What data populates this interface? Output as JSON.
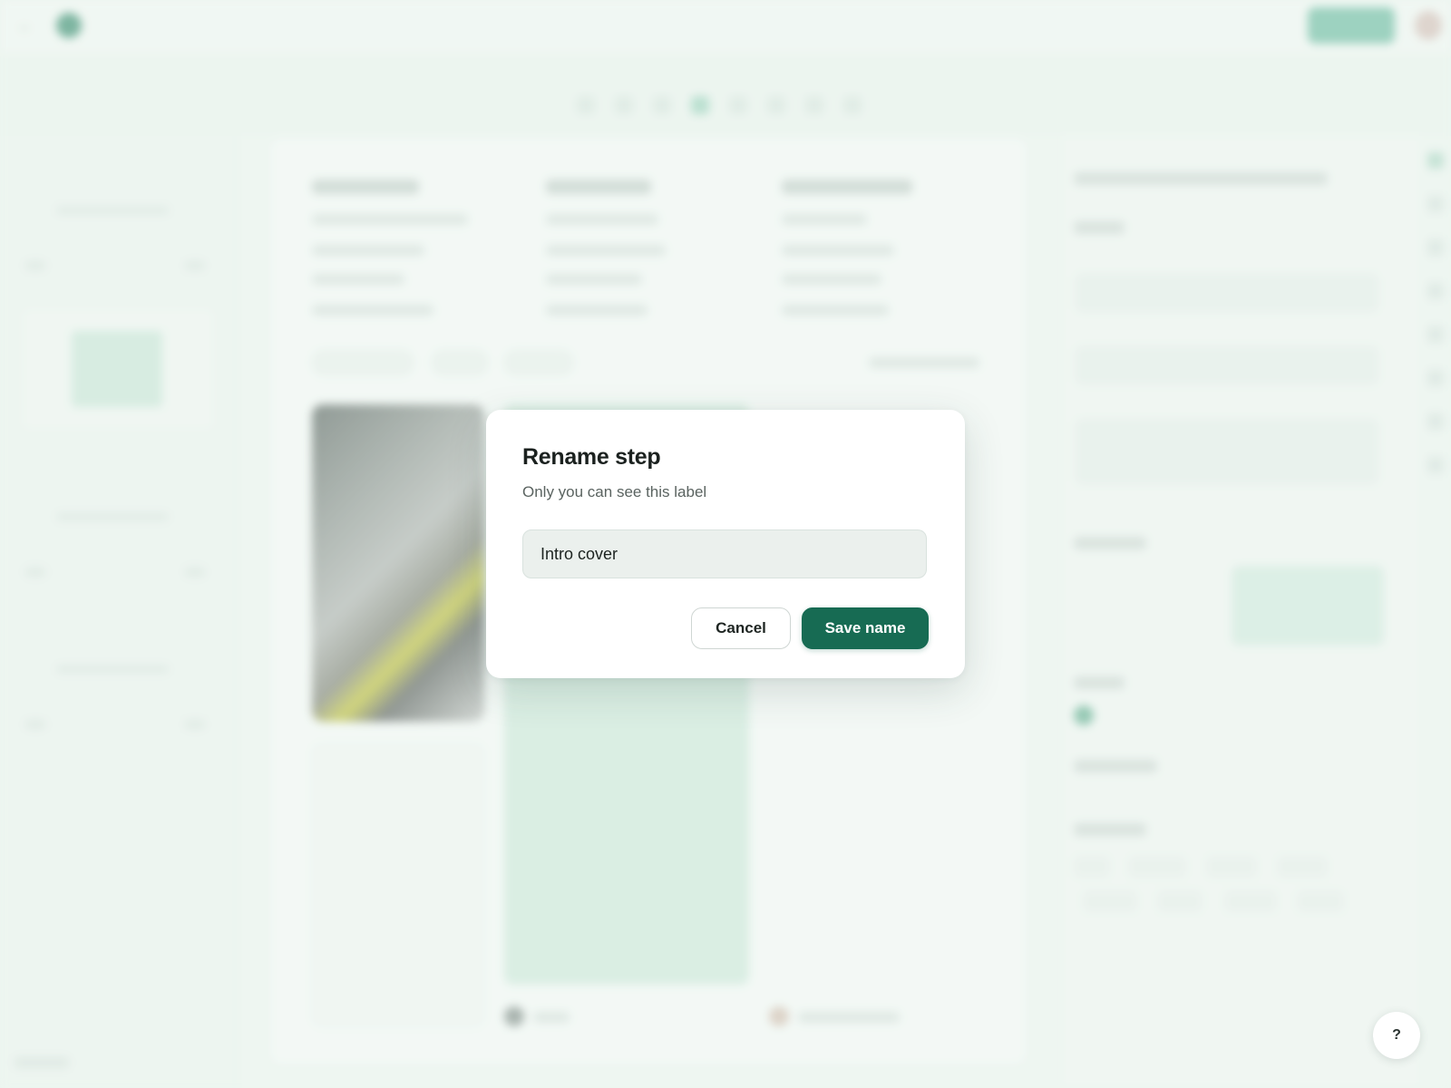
{
  "dialog": {
    "title": "Rename step",
    "subtitle": "Only you can see this label",
    "input_value": "Intro cover",
    "cancel_label": "Cancel",
    "save_label": "Save name"
  },
  "help": {
    "label": "?"
  },
  "colors": {
    "accent": "#176b53",
    "background": "#eef6f1",
    "modal": "#ffffff"
  }
}
